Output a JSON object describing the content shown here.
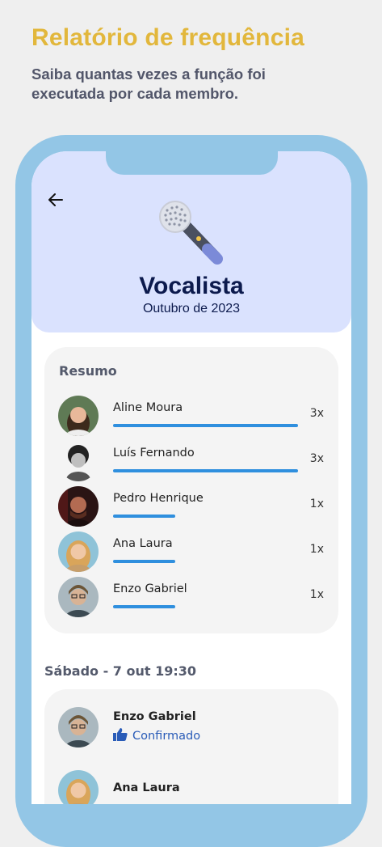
{
  "promo": {
    "title": "Relatório de frequência",
    "subtitle": "Saiba quantas vezes a função foi executada por cada membro."
  },
  "header": {
    "role": "Vocalista",
    "month": "Outubro de 2023",
    "icon": "microphone-icon"
  },
  "summary": {
    "title": "Resumo",
    "rows": [
      {
        "name": "Aline Moura",
        "count": "3x",
        "level": 1.0
      },
      {
        "name": "Luís Fernando",
        "count": "3x",
        "level": 1.0
      },
      {
        "name": "Pedro Henrique",
        "count": "1x",
        "level": 0.333
      },
      {
        "name": "Ana Laura",
        "count": "1x",
        "level": 0.333
      },
      {
        "name": "Enzo Gabriel",
        "count": "1x",
        "level": 0.333
      }
    ]
  },
  "event": {
    "date": "Sábado - 7 out 19:30",
    "members": [
      {
        "name": "Enzo Gabriel",
        "status": "Confirmado"
      },
      {
        "name": "Ana Laura",
        "status": ""
      }
    ]
  },
  "colors": {
    "accent": "#e2b73c",
    "bar": "#2f8fde",
    "confirmed": "#2a5cb8",
    "hero": "#dae2fe",
    "frame": "#93c6e6"
  }
}
